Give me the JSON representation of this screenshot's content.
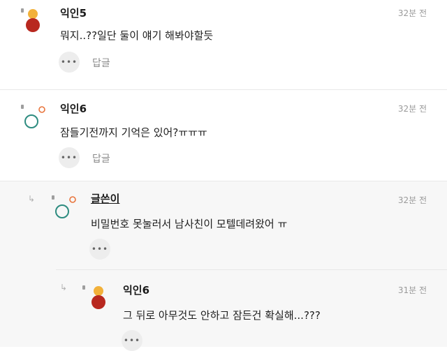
{
  "comments": [
    {
      "name": "익인5",
      "time": "32분 전",
      "text": "뭐지..??일단 둘이 얘기 해봐야할듯",
      "more": "•••",
      "reply": "답글"
    },
    {
      "name": "익인6",
      "time": "32분 전",
      "text": "잠들기전까지 기억은 있어?ㅠㅠㅠ",
      "more": "•••",
      "reply": "답글"
    },
    {
      "name": "글쓴이",
      "time": "32분 전",
      "text": "비밀번호 못눌러서 남사친이 모텔데려왔어 ㅠ",
      "more": "•••"
    },
    {
      "name": "익인6",
      "time": "31분 전",
      "text": "그 뒤로 아무것도 안하고 잠든건 확실해...???",
      "more": "•••"
    }
  ],
  "icons": {
    "reply_arrow": "reply-arrow-icon",
    "more": "more-dots-icon"
  },
  "colors": {
    "avatar_yellow": "#f2b13a",
    "avatar_red": "#b8281f",
    "avatar_orange": "#e8743b",
    "avatar_teal": "#2e8c80"
  }
}
